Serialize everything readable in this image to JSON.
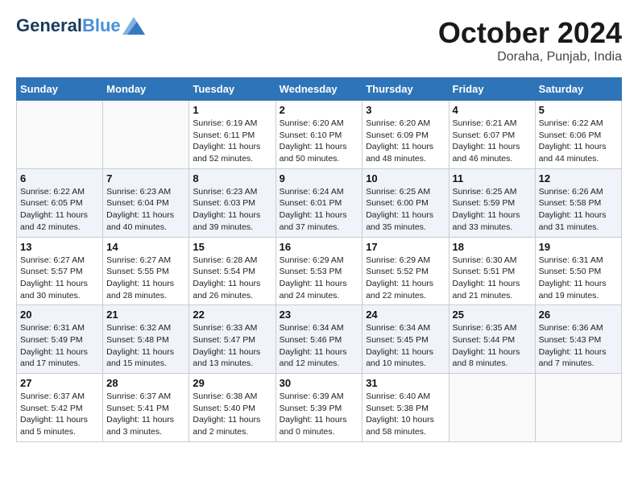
{
  "header": {
    "logo_line1": "General",
    "logo_line2": "Blue",
    "month": "October 2024",
    "location": "Doraha, Punjab, India"
  },
  "days_of_week": [
    "Sunday",
    "Monday",
    "Tuesday",
    "Wednesday",
    "Thursday",
    "Friday",
    "Saturday"
  ],
  "weeks": [
    [
      {
        "day": "",
        "info": ""
      },
      {
        "day": "",
        "info": ""
      },
      {
        "day": "1",
        "info": "Sunrise: 6:19 AM\nSunset: 6:11 PM\nDaylight: 11 hours and 52 minutes."
      },
      {
        "day": "2",
        "info": "Sunrise: 6:20 AM\nSunset: 6:10 PM\nDaylight: 11 hours and 50 minutes."
      },
      {
        "day": "3",
        "info": "Sunrise: 6:20 AM\nSunset: 6:09 PM\nDaylight: 11 hours and 48 minutes."
      },
      {
        "day": "4",
        "info": "Sunrise: 6:21 AM\nSunset: 6:07 PM\nDaylight: 11 hours and 46 minutes."
      },
      {
        "day": "5",
        "info": "Sunrise: 6:22 AM\nSunset: 6:06 PM\nDaylight: 11 hours and 44 minutes."
      }
    ],
    [
      {
        "day": "6",
        "info": "Sunrise: 6:22 AM\nSunset: 6:05 PM\nDaylight: 11 hours and 42 minutes."
      },
      {
        "day": "7",
        "info": "Sunrise: 6:23 AM\nSunset: 6:04 PM\nDaylight: 11 hours and 40 minutes."
      },
      {
        "day": "8",
        "info": "Sunrise: 6:23 AM\nSunset: 6:03 PM\nDaylight: 11 hours and 39 minutes."
      },
      {
        "day": "9",
        "info": "Sunrise: 6:24 AM\nSunset: 6:01 PM\nDaylight: 11 hours and 37 minutes."
      },
      {
        "day": "10",
        "info": "Sunrise: 6:25 AM\nSunset: 6:00 PM\nDaylight: 11 hours and 35 minutes."
      },
      {
        "day": "11",
        "info": "Sunrise: 6:25 AM\nSunset: 5:59 PM\nDaylight: 11 hours and 33 minutes."
      },
      {
        "day": "12",
        "info": "Sunrise: 6:26 AM\nSunset: 5:58 PM\nDaylight: 11 hours and 31 minutes."
      }
    ],
    [
      {
        "day": "13",
        "info": "Sunrise: 6:27 AM\nSunset: 5:57 PM\nDaylight: 11 hours and 30 minutes."
      },
      {
        "day": "14",
        "info": "Sunrise: 6:27 AM\nSunset: 5:55 PM\nDaylight: 11 hours and 28 minutes."
      },
      {
        "day": "15",
        "info": "Sunrise: 6:28 AM\nSunset: 5:54 PM\nDaylight: 11 hours and 26 minutes."
      },
      {
        "day": "16",
        "info": "Sunrise: 6:29 AM\nSunset: 5:53 PM\nDaylight: 11 hours and 24 minutes."
      },
      {
        "day": "17",
        "info": "Sunrise: 6:29 AM\nSunset: 5:52 PM\nDaylight: 11 hours and 22 minutes."
      },
      {
        "day": "18",
        "info": "Sunrise: 6:30 AM\nSunset: 5:51 PM\nDaylight: 11 hours and 21 minutes."
      },
      {
        "day": "19",
        "info": "Sunrise: 6:31 AM\nSunset: 5:50 PM\nDaylight: 11 hours and 19 minutes."
      }
    ],
    [
      {
        "day": "20",
        "info": "Sunrise: 6:31 AM\nSunset: 5:49 PM\nDaylight: 11 hours and 17 minutes."
      },
      {
        "day": "21",
        "info": "Sunrise: 6:32 AM\nSunset: 5:48 PM\nDaylight: 11 hours and 15 minutes."
      },
      {
        "day": "22",
        "info": "Sunrise: 6:33 AM\nSunset: 5:47 PM\nDaylight: 11 hours and 13 minutes."
      },
      {
        "day": "23",
        "info": "Sunrise: 6:34 AM\nSunset: 5:46 PM\nDaylight: 11 hours and 12 minutes."
      },
      {
        "day": "24",
        "info": "Sunrise: 6:34 AM\nSunset: 5:45 PM\nDaylight: 11 hours and 10 minutes."
      },
      {
        "day": "25",
        "info": "Sunrise: 6:35 AM\nSunset: 5:44 PM\nDaylight: 11 hours and 8 minutes."
      },
      {
        "day": "26",
        "info": "Sunrise: 6:36 AM\nSunset: 5:43 PM\nDaylight: 11 hours and 7 minutes."
      }
    ],
    [
      {
        "day": "27",
        "info": "Sunrise: 6:37 AM\nSunset: 5:42 PM\nDaylight: 11 hours and 5 minutes."
      },
      {
        "day": "28",
        "info": "Sunrise: 6:37 AM\nSunset: 5:41 PM\nDaylight: 11 hours and 3 minutes."
      },
      {
        "day": "29",
        "info": "Sunrise: 6:38 AM\nSunset: 5:40 PM\nDaylight: 11 hours and 2 minutes."
      },
      {
        "day": "30",
        "info": "Sunrise: 6:39 AM\nSunset: 5:39 PM\nDaylight: 11 hours and 0 minutes."
      },
      {
        "day": "31",
        "info": "Sunrise: 6:40 AM\nSunset: 5:38 PM\nDaylight: 10 hours and 58 minutes."
      },
      {
        "day": "",
        "info": ""
      },
      {
        "day": "",
        "info": ""
      }
    ]
  ]
}
